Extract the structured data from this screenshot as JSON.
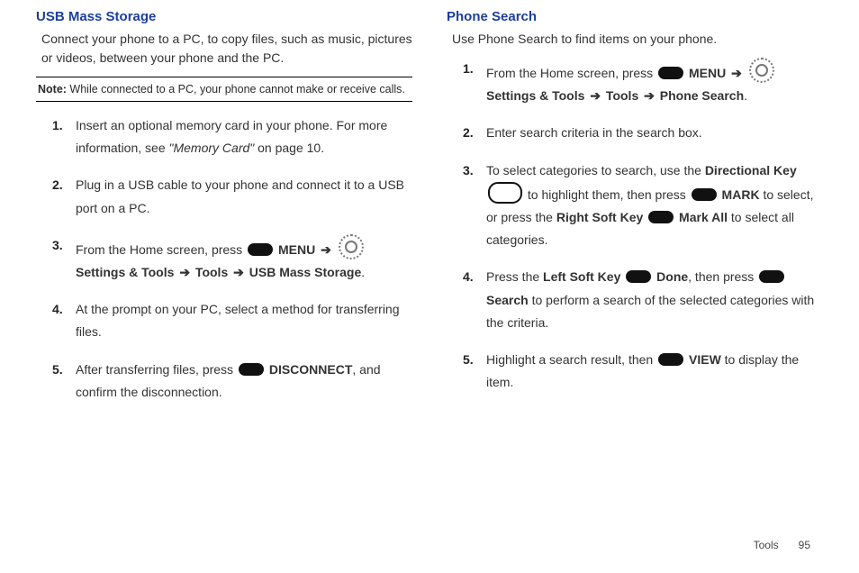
{
  "left": {
    "heading": "USB Mass Storage",
    "intro": "Connect your phone to a PC, to copy files, such as music, pictures or videos, between your phone and the PC.",
    "note_label": "Note:",
    "note_text": " While connected to a PC, your phone cannot make or receive calls.",
    "s1a": "Insert an optional memory card in your phone. For more information, see ",
    "s1b": "\"Memory Card\"",
    "s1c": " on page 10.",
    "s2": "Plug in a USB cable  to your phone and connect it to a USB port on a PC.",
    "s3a": "From the Home screen, press ",
    "s3b": " MENU ",
    "s3c": "  Settings & Tools ",
    "s3d": " Tools ",
    "s3e": " USB Mass Storage",
    "s4": "At the prompt on your PC, select a method for transferring files.",
    "s5a": "After transferring files, press ",
    "s5b": " DISCONNECT",
    "s5c": ", and confirm the disconnection."
  },
  "right": {
    "heading": "Phone Search",
    "intro": "Use Phone Search to find items on your phone.",
    "s1a": "From the Home screen, press ",
    "s1b": " MENU ",
    "s1c": "  Settings & Tools ",
    "s1d": " Tools ",
    "s1e": " Phone Search",
    "s2": "Enter search criteria in the search box.",
    "s3a": "To select categories to search, use the ",
    "s3b": "Directional Key",
    "s3c": " to highlight them, then press ",
    "s3d": " MARK",
    "s3e": " to select, or press the ",
    "s3f": "Right Soft Key",
    "s3g": " Mark All",
    "s3h": " to select all categories.",
    "s4a": "Press the ",
    "s4b": "Left Soft Key",
    "s4c": " Done",
    "s4d": ", then press ",
    "s4e": " Search",
    "s4f": " to perform a search of the selected categories with the criteria.",
    "s5a": "Highlight a search result, then ",
    "s5b": " VIEW",
    "s5c": " to display the item."
  },
  "footer": {
    "section": "Tools",
    "page": "95"
  },
  "glyphs": {
    "arrow": "➔"
  }
}
